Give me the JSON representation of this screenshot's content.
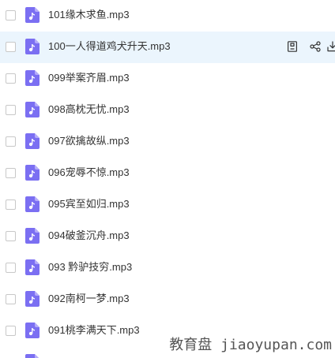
{
  "file_list": {
    "items": [
      {
        "name": "101缘木求鱼.mp3"
      },
      {
        "name": "100一人得道鸡犬升天.mp3"
      },
      {
        "name": "099举案齐眉.mp3"
      },
      {
        "name": "098高枕无忧.mp3"
      },
      {
        "name": "097欲擒故纵.mp3"
      },
      {
        "name": "096宠辱不惊.mp3"
      },
      {
        "name": "095宾至如归.mp3"
      },
      {
        "name": "094破釜沉舟.mp3"
      },
      {
        "name": "093 黔驴技穷.mp3"
      },
      {
        "name": "092南柯一梦.mp3"
      },
      {
        "name": "091桃李满天下.mp3"
      }
    ],
    "file_icon": "music-file-icon",
    "hovered_index": 1,
    "hover_actions": [
      {
        "icon": "file-info-icon"
      },
      {
        "icon": "share-icon"
      },
      {
        "icon": "download-icon"
      }
    ]
  },
  "watermark": {
    "text": "教育盘 jiaoyupan.com"
  },
  "colors": {
    "text": "#333333",
    "hover_row": "#ebf5fd",
    "file_icon": "#7b6ff2",
    "file_icon_fold": "#b5acf9",
    "checkbox_border": "#c8c8c8",
    "action_icon": "#333333",
    "watermark": "#555555"
  }
}
